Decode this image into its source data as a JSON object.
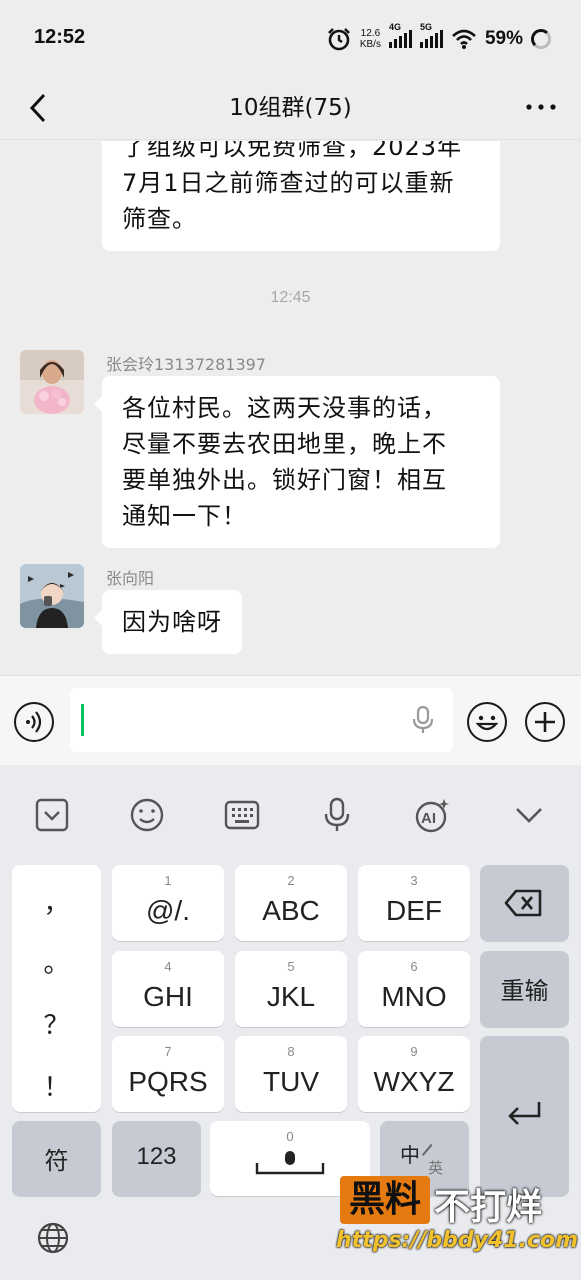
{
  "status_bar": {
    "time": "12:52",
    "net_speed_value": "12.6",
    "net_speed_unit": "KB/s",
    "signal1_label": "4G",
    "signal2_label": "5G",
    "battery": "59%"
  },
  "header": {
    "title": "10组群(75)",
    "back_icon": "chevron-left-icon",
    "more_icon": "more-dots-icon"
  },
  "messages": [
    {
      "type": "text",
      "partial": true,
      "lines": [
        "了组级可以免费筛查，2023年",
        "7月1日之前筛查过的可以重新",
        "筛查。"
      ]
    },
    {
      "type": "timestamp",
      "text": "12:45"
    },
    {
      "type": "text",
      "sender": "张会玲13137281397",
      "lines": [
        "各位村民。这两天没事的话，",
        "尽量不要去农田地里，晚上不",
        "要单独外出。锁好门窗！相互",
        "通知一下！"
      ]
    },
    {
      "type": "text",
      "sender": "张向阳",
      "lines": [
        "因为啥呀"
      ]
    }
  ],
  "input_bar": {
    "voice_icon": "voice-mode-icon",
    "mic_icon": "microphone-icon",
    "emoji_icon": "emoji-icon",
    "plus_icon": "plus-icon",
    "value": ""
  },
  "keyboard": {
    "toolbar_icons": [
      "keyboard-hide-icon",
      "emoji-icon",
      "keyboard-icon",
      "microphone-icon",
      "ai-icon",
      "chevron-down-icon"
    ],
    "punctuation": [
      "，",
      "。",
      "？",
      "！"
    ],
    "keys": [
      {
        "num": "1",
        "label": "@/."
      },
      {
        "num": "2",
        "label": "ABC"
      },
      {
        "num": "3",
        "label": "DEF"
      },
      {
        "num": "4",
        "label": "GHI"
      },
      {
        "num": "5",
        "label": "JKL"
      },
      {
        "num": "6",
        "label": "MNO"
      },
      {
        "num": "7",
        "label": "PQRS"
      },
      {
        "num": "8",
        "label": "TUV"
      },
      {
        "num": "9",
        "label": "WXYZ"
      }
    ],
    "reinput_label": "重输",
    "symbol_label": "符",
    "numbers_label": "123",
    "space_num": "0",
    "lang_main": "中",
    "lang_sub": "英",
    "globe_icon": "globe-icon"
  },
  "watermark": {
    "box_text": "黑料",
    "text": "不打烊",
    "url": "https://bbdy41.com"
  }
}
